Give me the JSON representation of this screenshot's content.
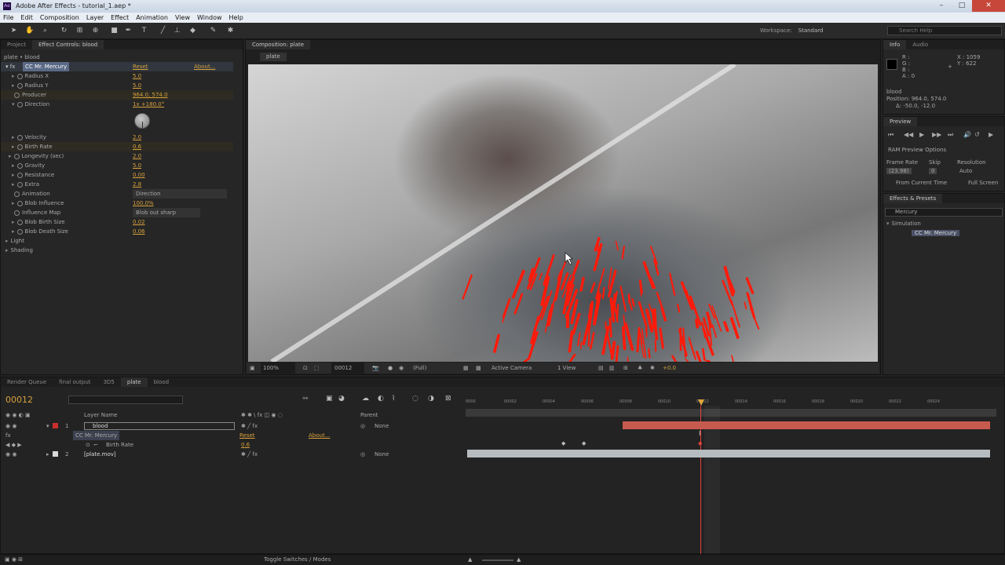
{
  "window": {
    "title": "Adobe After Effects - tutorial_1.aep *",
    "logo": "Ae"
  },
  "menu": [
    "File",
    "Edit",
    "Composition",
    "Layer",
    "Effect",
    "Animation",
    "View",
    "Window",
    "Help"
  ],
  "toolbar": {
    "workspace_label": "Workspace:",
    "workspace_value": "Standard",
    "search_placeholder": "Search Help"
  },
  "left_panel": {
    "tabs": [
      "Project",
      "Effect Controls: blood"
    ],
    "subtitle": "plate • blood",
    "effect_name": "CC Mr. Mercury",
    "reset": "Reset",
    "about": "About...",
    "params": [
      {
        "label": "Radius X",
        "value": "5.0"
      },
      {
        "label": "Radius Y",
        "value": "5.0"
      },
      {
        "label": "Producer",
        "value": "964.0, 574.0"
      },
      {
        "label": "Direction",
        "value": "1x +180.0°"
      },
      {
        "label": "Velocity",
        "value": "2.0"
      },
      {
        "label": "Birth Rate",
        "value": "0.6"
      },
      {
        "label": "Longevity (sec)",
        "value": "2.0"
      },
      {
        "label": "Gravity",
        "value": "5.0"
      },
      {
        "label": "Resistance",
        "value": "0.00"
      },
      {
        "label": "Extra",
        "value": "2.8"
      },
      {
        "label": "Animation",
        "value": "Direction"
      },
      {
        "label": "Blob Influence",
        "value": "100.0%"
      },
      {
        "label": "Influence Map",
        "value": "Blob out sharp"
      },
      {
        "label": "Blob Birth Size",
        "value": "0.02"
      },
      {
        "label": "Blob Death Size",
        "value": "0.06"
      },
      {
        "label": "Light",
        "value": ""
      },
      {
        "label": "Shading",
        "value": ""
      }
    ]
  },
  "composition": {
    "tab": "Composition: plate",
    "subtab": "plate",
    "zoom": "100%",
    "timecode": "00012",
    "quality": "(Full)",
    "camera": "Active Camera",
    "views": "1 View",
    "exposure": "+0.0"
  },
  "info_panel": {
    "tabs": [
      "Info",
      "Audio"
    ],
    "r": "R :",
    "g": "G :",
    "b": "B :",
    "a": "A : 0",
    "x": "X : 1059",
    "y": "Y : 622",
    "layer": "blood",
    "position": "Position: 964.0, 574.0",
    "delta": "Δ: -50.0, -12.0"
  },
  "preview_panel": {
    "tab": "Preview",
    "ram_options": "RAM Preview Options",
    "frame_rate_label": "Frame Rate",
    "skip_label": "Skip",
    "resolution_label": "Resolution",
    "frame_rate": "(23.98)",
    "skip": "0",
    "resolution": "Auto",
    "from_current": "From Current Time",
    "full_screen": "Full Screen"
  },
  "effects_panel": {
    "tab": "Effects & Presets",
    "search": "Mercury",
    "category": "Simulation",
    "item": "CC Mr. Mercury"
  },
  "timeline": {
    "tabs": [
      "Render Queue",
      "final output",
      "3D5",
      "plate",
      "blood"
    ],
    "timecode": "00012",
    "col_layer_name": "Layer Name",
    "col_parent": "Parent",
    "layers": [
      {
        "num": "1",
        "name": "blood",
        "parent": "None",
        "color": "#c9302c"
      },
      {
        "num": "2",
        "name": "[plate.mov]",
        "parent": "None",
        "color": "#d8d8d8"
      }
    ],
    "effect_row": "CC Mr. Mercury",
    "effect_reset": "Reset",
    "effect_about": "About...",
    "prop_row": "Birth Rate",
    "prop_value": "0.6",
    "ruler": [
      "0000",
      "00002",
      "00004",
      "00006",
      "00008",
      "00010",
      "00012",
      "00014",
      "00016",
      "00018",
      "00020",
      "00022",
      "00024"
    ],
    "toggle": "Toggle Switches / Modes"
  },
  "colors": {
    "accent": "#d6a13c",
    "blob": "#ff1a0a",
    "layer_bar": "#c75a4e",
    "playhead": "#e0443a"
  }
}
